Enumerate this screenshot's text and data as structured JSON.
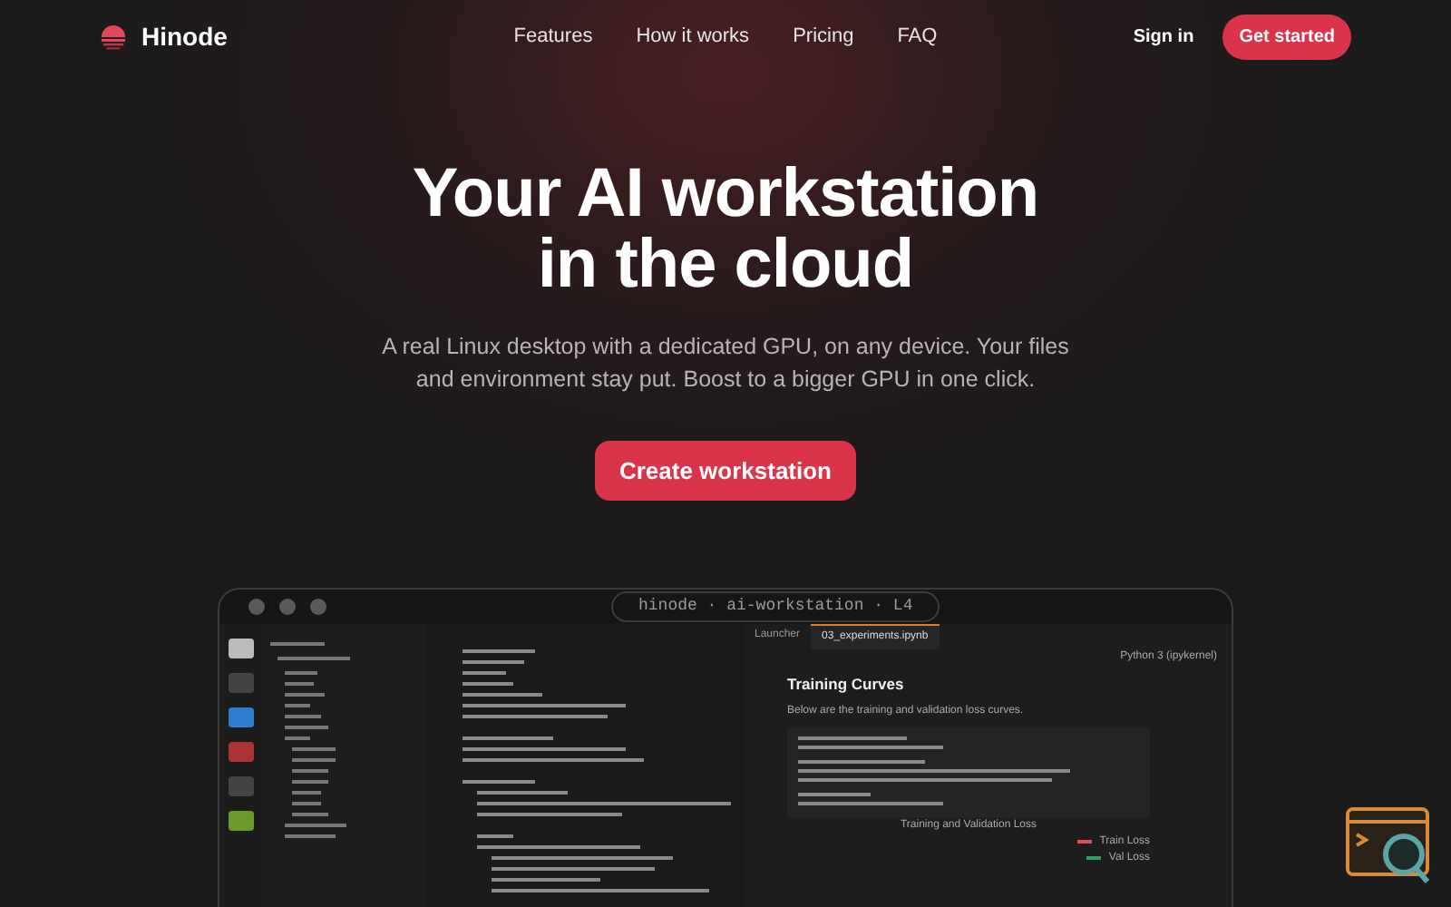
{
  "brand": {
    "name": "Hinode"
  },
  "nav": {
    "links": [
      "Features",
      "How it works",
      "Pricing",
      "FAQ"
    ],
    "sign_in": "Sign in",
    "cta": "Get started"
  },
  "hero": {
    "title_lines": [
      "Your AI workstation",
      "in the cloud"
    ],
    "subtitle": "A real Linux desktop with a dedicated GPU, on any device. Your files and environment stay put. Boost to a bigger GPU in one click.",
    "button": "Create workstation"
  },
  "preview": {
    "address": "hinode · ai-workstation · L4",
    "tabs": [
      {
        "label": "Launcher",
        "selected": false
      },
      {
        "label": "03_experiments.ipynb",
        "selected": true
      }
    ],
    "kernel": "Python 3 (ipykernel)",
    "notebook_heading": "Training Curves",
    "notebook_text": "Below are the training and validation loss curves.",
    "chart_title": "Training and Validation Loss",
    "legend": [
      {
        "label": "Train Loss",
        "color": "#e0485c"
      },
      {
        "label": "Val Loss",
        "color": "#2e9e5e"
      }
    ]
  }
}
